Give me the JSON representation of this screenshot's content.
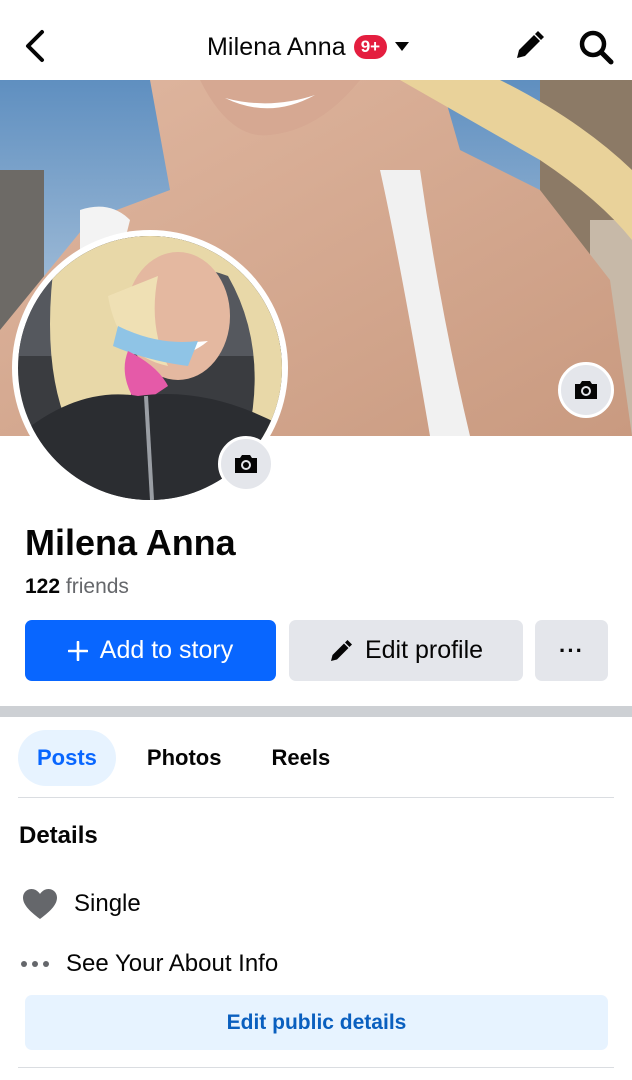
{
  "header": {
    "title": "Milena Anna",
    "badge": "9+",
    "icons": [
      "back-icon",
      "caret-down-icon",
      "pencil-icon",
      "search-icon"
    ]
  },
  "profile": {
    "name": "Milena Anna",
    "friends_count": "122",
    "friends_label": "friends"
  },
  "actions": {
    "add_story": "Add to story",
    "edit_profile": "Edit profile",
    "more": "···"
  },
  "tabs": [
    {
      "label": "Posts",
      "active": true
    },
    {
      "label": "Photos",
      "active": false
    },
    {
      "label": "Reels",
      "active": false
    }
  ],
  "details": {
    "title": "Details",
    "relationship": "Single",
    "about_link": "See Your About Info",
    "edit_button": "Edit public details"
  },
  "colors": {
    "primary": "#0866ff",
    "badge": "#e41e3f",
    "secondary_button": "#e4e6eb",
    "tab_active_bg": "#e7f3ff"
  }
}
